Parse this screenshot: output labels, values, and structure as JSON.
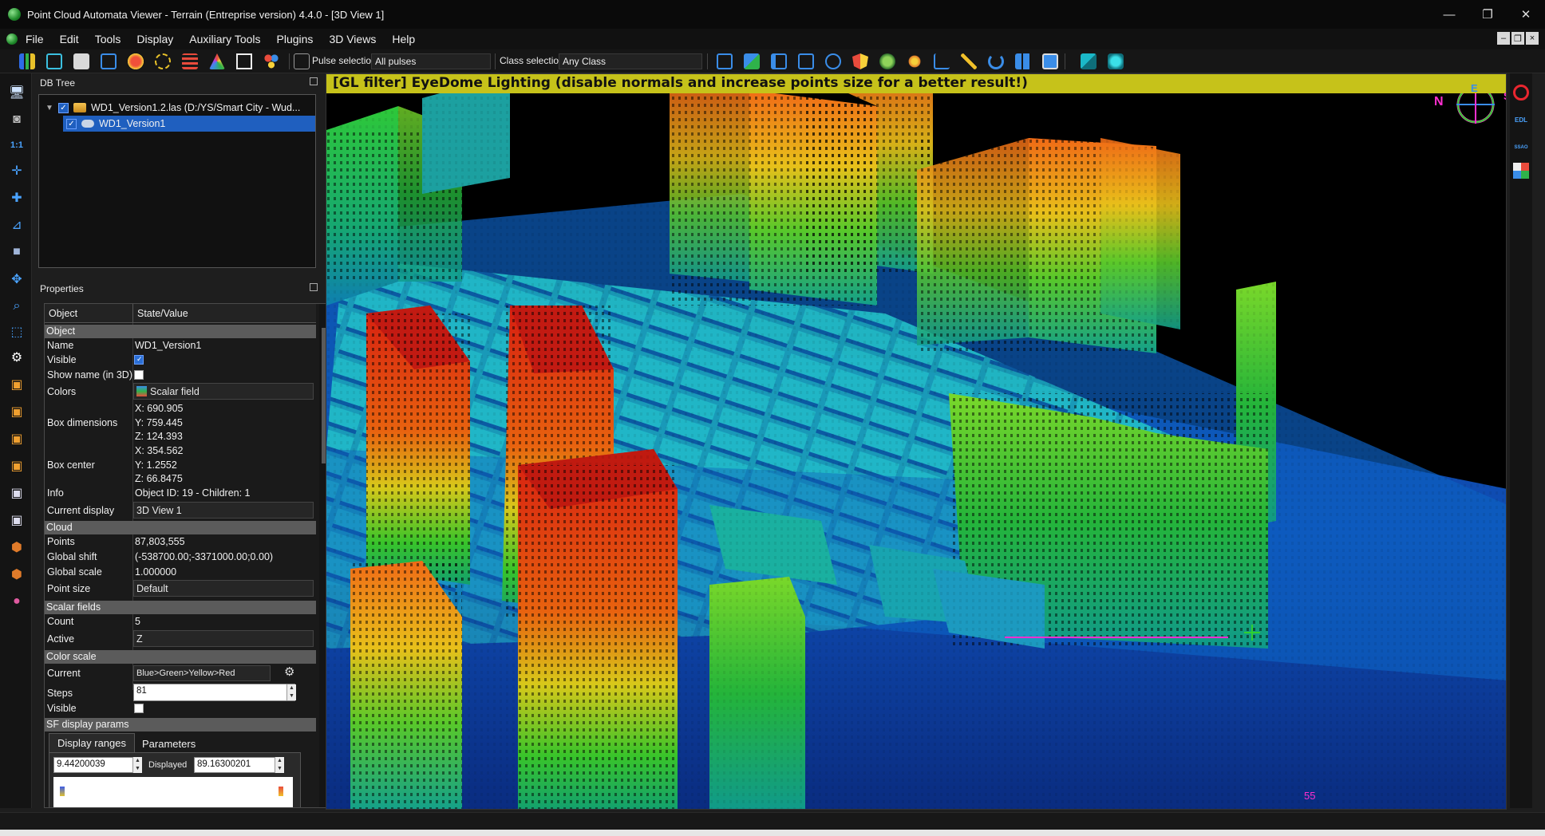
{
  "window": {
    "title": "Point Cloud Automata Viewer - Terrain (Entreprise version) 4.4.0 - [3D View 1]",
    "controls": {
      "minimize": "—",
      "maximize": "❐",
      "close": "✕"
    }
  },
  "menu": {
    "items": [
      "File",
      "Edit",
      "Tools",
      "Display",
      "Auxiliary Tools",
      "Plugins",
      "3D Views",
      "Help"
    ],
    "mdi_controls": [
      "–",
      "❐",
      "×"
    ]
  },
  "toolbar": {
    "pulse_label": "Pulse selection:",
    "pulse_value": "All pulses",
    "class_label": "Class selection:",
    "class_value": "Any Class"
  },
  "db_tree": {
    "title": "DB Tree",
    "items": [
      {
        "label": "WD1_Version1.2.las (D:/YS/Smart City - Wud...",
        "checked": true,
        "icon": "folder-icon"
      },
      {
        "label": "WD1_Version1",
        "checked": true,
        "icon": "point-cloud-icon",
        "selected": true
      }
    ]
  },
  "properties": {
    "title": "Properties",
    "header": {
      "col1": "Object",
      "col2": "State/Value"
    },
    "sections": {
      "object": "Object",
      "cloud": "Cloud",
      "scalar_fields": "Scalar fields",
      "color_scale": "Color scale",
      "sf_display": "SF display params"
    },
    "rows": {
      "name": {
        "label": "Name",
        "value": "WD1_Version1"
      },
      "visible": {
        "label": "Visible",
        "checked": true
      },
      "show_name": {
        "label": "Show name (in 3D)",
        "checked": false
      },
      "colors": {
        "label": "Colors",
        "value": "Scalar field"
      },
      "box_dimensions": {
        "label": "Box dimensions",
        "x": "X: 690.905",
        "y": "Y: 759.445",
        "z": "Z: 124.393"
      },
      "box_center": {
        "label": "Box center",
        "x": "X: 354.562",
        "y": "Y: 1.2552",
        "z": "Z: 66.8475"
      },
      "info": {
        "label": "Info",
        "value": "Object ID: 19 - Children: 1"
      },
      "current_display": {
        "label": "Current display",
        "value": "3D View 1"
      },
      "points": {
        "label": "Points",
        "value": "87,803,555"
      },
      "global_shift": {
        "label": "Global shift",
        "value": "(-538700.00;-3371000.00;0.00)"
      },
      "global_scale": {
        "label": "Global scale",
        "value": "1.000000"
      },
      "point_size": {
        "label": "Point size",
        "value": "Default"
      },
      "count": {
        "label": "Count",
        "value": "5"
      },
      "active": {
        "label": "Active",
        "value": "Z"
      },
      "current": {
        "label": "Current",
        "value": "Blue>Green>Yellow>Red"
      },
      "steps": {
        "label": "Steps",
        "value": "81"
      },
      "cs_visible": {
        "label": "Visible",
        "checked": false
      }
    },
    "sf_tabs": [
      "Display ranges",
      "Parameters"
    ],
    "sf_range": {
      "min": "9.44200039",
      "displayed_label": "Displayed",
      "displayed": "89.16300201"
    }
  },
  "view3d": {
    "banner": "[GL filter] EyeDome Lighting (disable normals and increase points size for a better result!)",
    "compass": {
      "left": "N",
      "right": "S",
      "top": "E"
    },
    "scale_label": "55"
  },
  "right_toolbar": {
    "edl_label": "EDL",
    "ssao_label": "SSAO"
  },
  "colors": {
    "banner_bg": "#c6c21a",
    "selection": "#1f5fbf",
    "icon_blue": "#4aa3ff",
    "scale_magenta": "#ff2fd0"
  }
}
